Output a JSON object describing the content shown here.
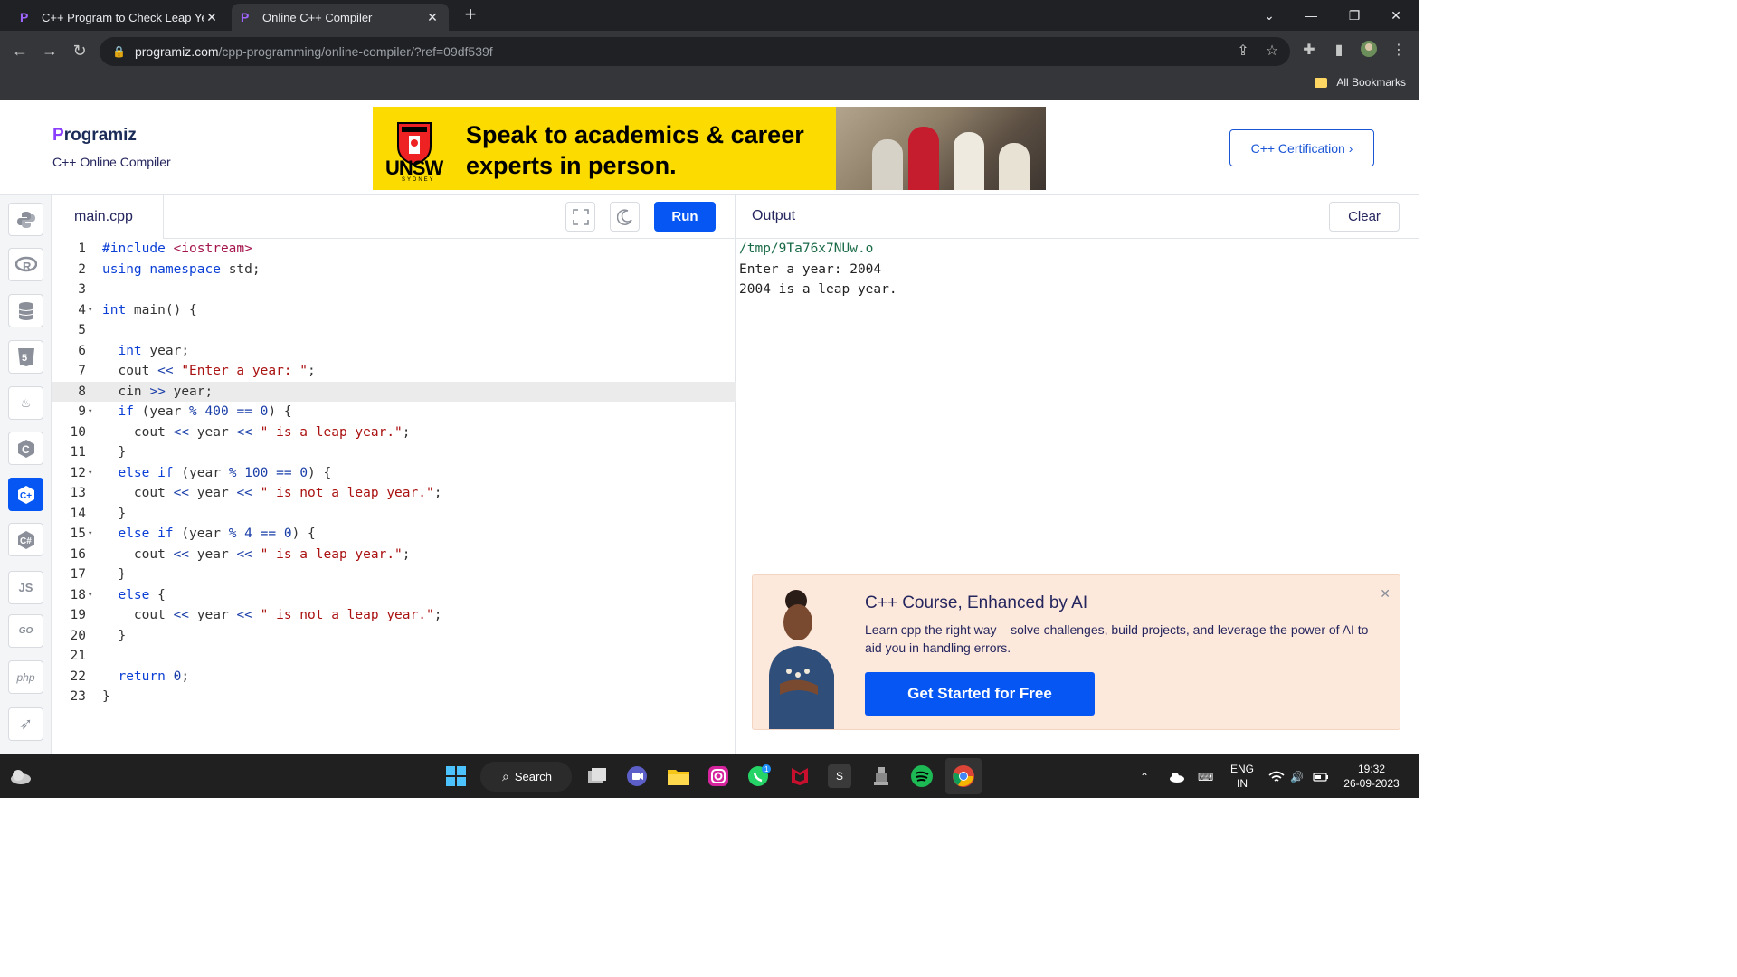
{
  "browser": {
    "tabs": [
      {
        "title": "C++ Program to Check Leap Year"
      },
      {
        "title": "Online C++ Compiler"
      }
    ],
    "url_host": "programiz.com",
    "url_path": "/cpp-programming/online-compiler/?ref=09df539f",
    "bookmarks_label": "All Bookmarks"
  },
  "header": {
    "logo_text": "rogramiz",
    "logo_p": "P",
    "subtitle": "C++ Online Compiler",
    "ad": {
      "headline": "Speak to academics & career experts in person.",
      "brand": "UNSW",
      "brand_sub": "SYDNEY"
    },
    "cert_button": "C++ Certification ›"
  },
  "languages": [
    {
      "name": "python-icon",
      "glyph": "⌘"
    },
    {
      "name": "r-icon",
      "glyph": "R"
    },
    {
      "name": "sql-icon",
      "glyph": "≡"
    },
    {
      "name": "html5-icon",
      "glyph": "5"
    },
    {
      "name": "java-icon",
      "glyph": "♨"
    },
    {
      "name": "c-icon",
      "glyph": "C"
    },
    {
      "name": "cpp-icon",
      "glyph": "C+",
      "active": true
    },
    {
      "name": "csharp-icon",
      "glyph": "C#"
    },
    {
      "name": "js-icon",
      "glyph": "JS"
    },
    {
      "name": "go-icon",
      "glyph": "GO"
    },
    {
      "name": "php-icon",
      "glyph": "php"
    },
    {
      "name": "swift-icon",
      "glyph": "➶"
    }
  ],
  "editor": {
    "filename": "main.cpp",
    "run_label": "Run",
    "highlighted_line": 8,
    "lines": [
      "#include <iostream>",
      "using namespace std;",
      "",
      "int main() {",
      "",
      "  int year;",
      "  cout << \"Enter a year: \";",
      "  cin >> year;",
      "  if (year % 400 == 0) {",
      "    cout << year << \" is a leap year.\";",
      "  }",
      "  else if (year % 100 == 0) {",
      "    cout << year << \" is not a leap year.\";",
      "  }",
      "  else if (year % 4 == 0) {",
      "    cout << year << \" is a leap year.\";",
      "  }",
      "  else {",
      "    cout << year << \" is not a leap year.\";",
      "  }",
      "",
      "  return 0;",
      "}"
    ],
    "fold_lines": [
      4,
      9,
      12,
      15,
      18
    ]
  },
  "output": {
    "title": "Output",
    "clear_label": "Clear",
    "lines": [
      "/tmp/9Ta76x7NUw.o",
      "Enter a year: 2004",
      "2004 is a leap year."
    ]
  },
  "course_ad": {
    "title": "C++ Course, Enhanced by AI",
    "description": "Learn cpp the right way – solve challenges, build projects, and leverage the power of AI to aid you in handling errors.",
    "button": "Get Started for Free"
  },
  "taskbar": {
    "search_label": "Search",
    "lang_line1": "ENG",
    "lang_line2": "IN",
    "time": "19:32",
    "date": "26-09-2023",
    "whatsapp_badge": "1"
  },
  "colors": {
    "accent": "#0556f3",
    "brand_purple": "#8a3ffc",
    "ad_yellow": "#fbdb00",
    "course_bg": "#fde8dc"
  }
}
